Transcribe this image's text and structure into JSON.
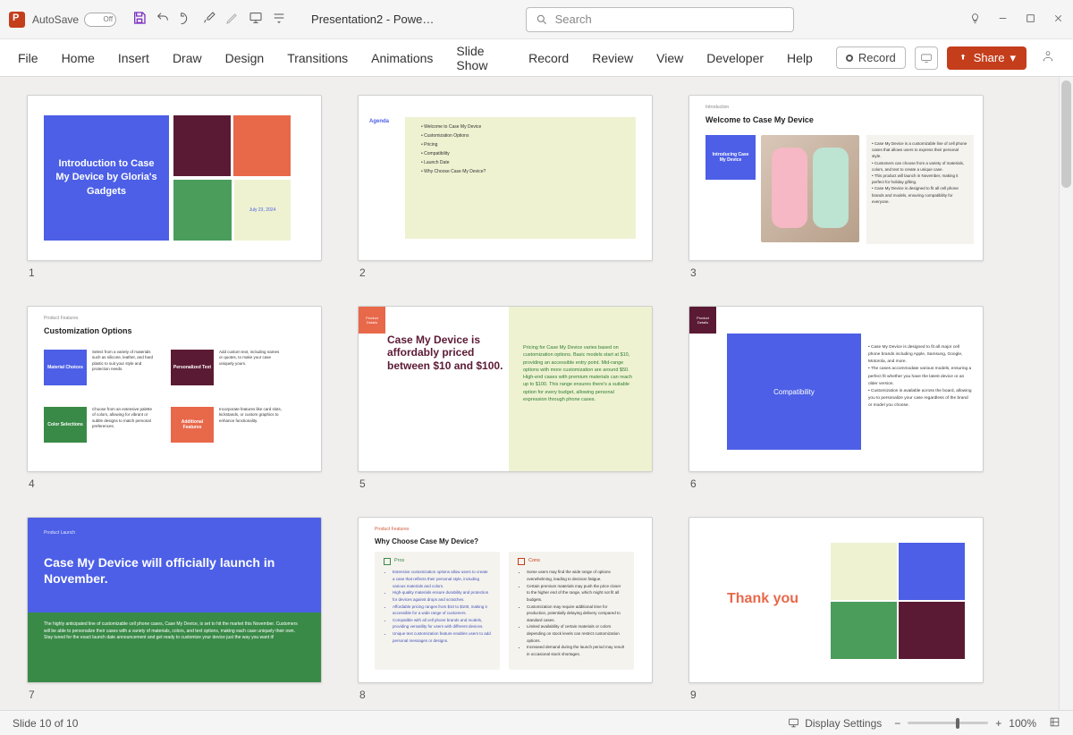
{
  "titlebar": {
    "autosave_label": "AutoSave",
    "autosave_state": "Off",
    "doc_title": "Presentation2 - Powe…",
    "search_placeholder": "Search"
  },
  "ribbon": {
    "tabs": [
      "File",
      "Home",
      "Insert",
      "Draw",
      "Design",
      "Transitions",
      "Animations",
      "Slide Show",
      "Record",
      "Review",
      "View",
      "Developer",
      "Help"
    ],
    "record_label": "Record",
    "share_label": "Share"
  },
  "slides": {
    "count": 10,
    "s1": {
      "title": "Introduction to Case My Device by Gloria's Gadgets",
      "date": "July 23, 2024"
    },
    "s2": {
      "label": "Agenda",
      "items": [
        "Welcome to Case My Device",
        "Customization Options",
        "Pricing",
        "Compatibility",
        "Launch Date",
        "Why Choose Case My Device?"
      ]
    },
    "s3": {
      "crumb": "Introduction",
      "title": "Welcome to Case My Device",
      "block": "Introducing Case My Device",
      "bullets": [
        "Case My Device is a customizable line of cell phone cases that allows users to express their personal style.",
        "Customers can choose from a variety of materials, colors, and text to create a unique case.",
        "This product will launch in November, making it perfect for holiday gifting.",
        "Case My Device is designed to fit all cell phone brands and models, ensuring compatibility for everyone."
      ]
    },
    "s4": {
      "crumb": "Product Features",
      "title": "Customization Options",
      "blocks": [
        "Material Choices",
        "Personalized Text",
        "Color Selections",
        "Additional Features"
      ],
      "texts": [
        "Select from a variety of materials such as silicone, leather, and hard plastic to suit your style and protection needs.",
        "Add custom text, including names or quotes, to make your case uniquely yours.",
        "Choose from an extensive palette of colors, allowing for vibrant or subtle designs to match personal preferences.",
        "Incorporate features like card slots, kickstands, or custom graphics to enhance functionality."
      ]
    },
    "s5": {
      "crumb": "Product Details",
      "title": "Case My Device is affordably priced between $10 and $100.",
      "body": "Pricing for Case My Device varies based on customization options. Basic models start at $10, providing an accessible entry point. Mid-range options with more customization are around $50. High-end cases with premium materials can reach up to $100. This range ensures there's a suitable option for every budget, allowing personal expression through phone cases."
    },
    "s6": {
      "crumb": "Product Details",
      "block": "Compatibility",
      "bullets": [
        "Case My Device is designed to fit all major cell phone brands including Apple, Samsung, Google, Motorola, and more.",
        "The cases accommodate various models, ensuring a perfect fit whether you have the latest device or an older version.",
        "Customization is available across the board, allowing you to personalize your case regardless of the brand or model you choose."
      ]
    },
    "s7": {
      "crumb": "Product Launch",
      "title": "Case My Device will officially launch in November.",
      "body": "The highly anticipated line of customizable cell phone cases, Case My Device, is set to hit the market this November. Customers will be able to personalize their cases with a variety of materials, colors, and text options, making each case uniquely their own. Stay tuned for the exact launch date announcement and get ready to customize your device just the way you want it!"
    },
    "s8": {
      "crumb": "Product Features",
      "title": "Why Choose Case My Device?",
      "pros_label": "Pros",
      "cons_label": "Cons",
      "pros": [
        "Extensive customization options allow users to create a case that reflects their personal style, including various materials and colors.",
        "High-quality materials ensure durability and protection for devices against drops and scratches.",
        "Affordable pricing ranges from $10 to $100, making it accessible for a wide range of customers.",
        "Compatible with all cell phone brands and models, providing versatility for users with different devices.",
        "Unique text customization feature enables users to add personal messages or designs."
      ],
      "cons": [
        "Some users may find the wide range of options overwhelming, leading to decision fatigue.",
        "Certain premium materials may push the price closer to the higher end of the range, which might not fit all budgets.",
        "Customization may require additional time for production, potentially delaying delivery compared to standard cases.",
        "Limited availability of certain materials or colors depending on stock levels can restrict customization options.",
        "Increased demand during the launch period may result in occasional stock shortages."
      ]
    },
    "s9": {
      "title": "Thank you"
    }
  },
  "status": {
    "slide_counter": "Slide  10  of  10",
    "display_settings": "Display Settings",
    "zoom_label": "100%"
  }
}
